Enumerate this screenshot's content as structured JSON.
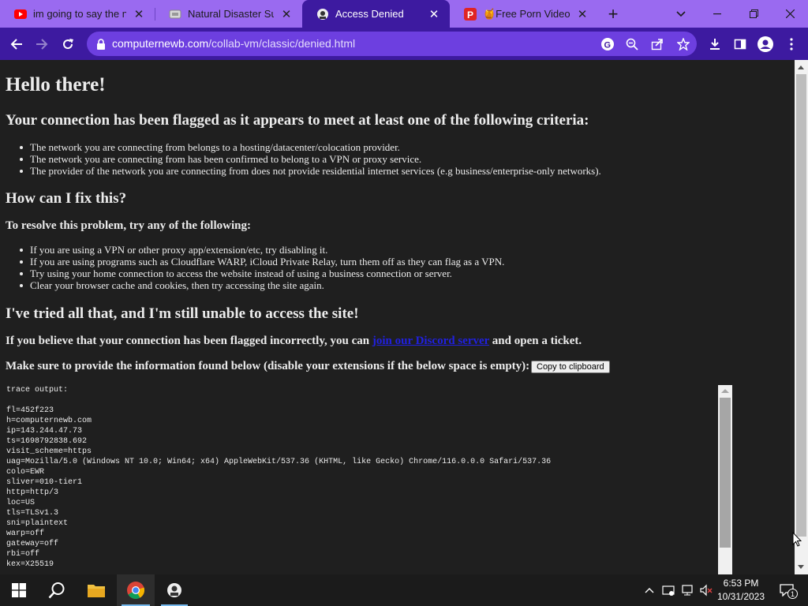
{
  "browser": {
    "tabs": [
      {
        "title": "im going to say the n w",
        "favicon": "youtube-icon",
        "active": false
      },
      {
        "title": "Natural Disaster Surviv",
        "favicon": "roblox-icon",
        "active": false
      },
      {
        "title": "Access Denied",
        "favicon": "collabvm-icon",
        "active": true
      },
      {
        "title": "🍯Free Porn Videos - (",
        "favicon": "p-icon",
        "active": false
      }
    ],
    "url_domain": "computernewb.com",
    "url_path": "/collab-vm/classic/denied.html"
  },
  "page": {
    "heading": "Hello there!",
    "criteria_heading": "Your connection has been flagged as it appears to meet at least one of the following criteria:",
    "criteria": [
      "The network you are connecting from belongs to a hosting/datacenter/colocation provider.",
      "The network you are connecting from has been confirmed to belong to a VPN or proxy service.",
      "The provider of the network you are connecting from does not provide residential internet services (e.g business/enterprise-only networks)."
    ],
    "fix_heading": "How can I fix this?",
    "resolve_heading": "To resolve this problem, try any of the following:",
    "fixes": [
      "If you are using a VPN or other proxy app/extension/etc, try disabling it.",
      "If you are using programs such as Cloudflare WARP, iCloud Private Relay, turn them off as they can flag as a VPN.",
      "Try using your home connection to access the website instead of using a business connection or server.",
      "Clear your browser cache and cookies, then try accessing the site again."
    ],
    "still_heading": "I've tried all that, and I'm still unable to access the site!",
    "ticket_prefix": "If you believe that your connection has been flagged incorrectly, you can ",
    "ticket_link": "join our Discord server",
    "ticket_suffix": " and open a ticket.",
    "info_text": "Make sure to provide the information found below (disable your extensions if the below space is empty):",
    "copy_button": "Copy to clipboard",
    "trace_lines": [
      "trace output:",
      "",
      "fl=452f223",
      "h=computernewb.com",
      "ip=143.244.47.73",
      "ts=1698792838.692",
      "visit_scheme=https",
      "uag=Mozilla/5.0 (Windows NT 10.0; Win64; x64) AppleWebKit/537.36 (KHTML, like Gecko) Chrome/116.0.0.0 Safari/537.36",
      "colo=EWR",
      "sliver=010-tier1",
      "http=http/3",
      "loc=US",
      "tls=TLSv1.3",
      "sni=plaintext",
      "warp=off",
      "gateway=off",
      "rbi=off",
      "kex=X25519"
    ]
  },
  "taskbar": {
    "time": "6:53 PM",
    "date": "10/31/2023",
    "notification_count": "1"
  },
  "colors": {
    "tabstrip": "#9a6af0",
    "toolbar": "#3d1aa0",
    "omnibox": "#6d3fe0",
    "page_bg": "#1f1f1f",
    "link": "#2020e0"
  }
}
